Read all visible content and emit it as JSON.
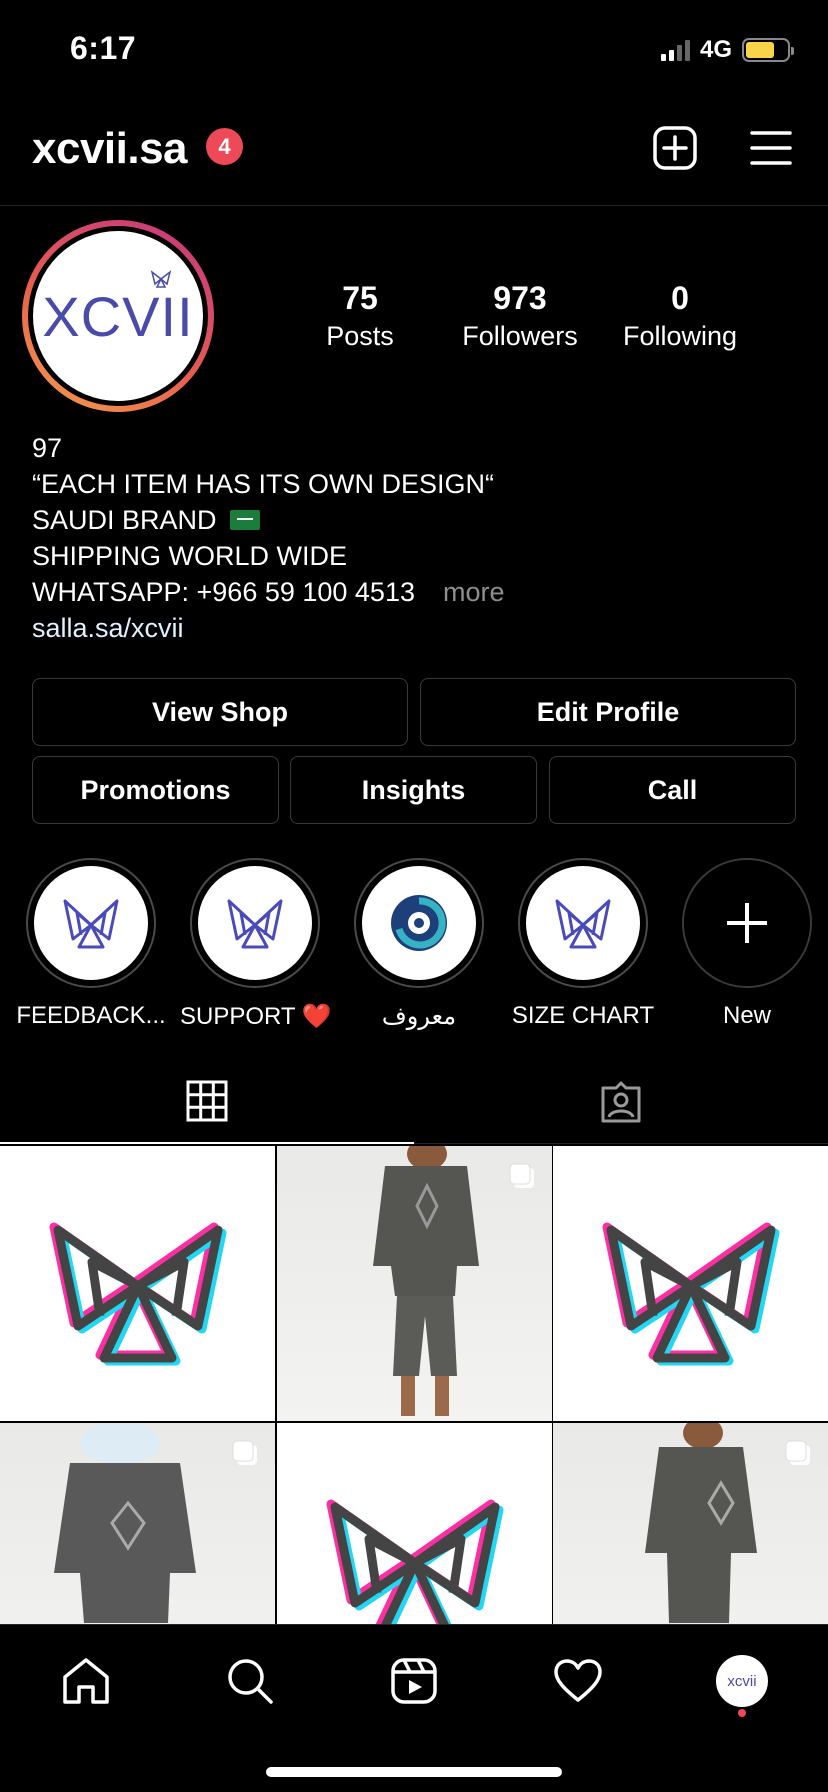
{
  "status_bar": {
    "time": "6:17",
    "network": "4G",
    "battery_level": 0.7
  },
  "header": {
    "username": "xcvii.sa",
    "notification_count": "4"
  },
  "profile": {
    "avatar_text": "XCVII",
    "stats": [
      {
        "number": "75",
        "label": "Posts"
      },
      {
        "number": "973",
        "label": "Followers"
      },
      {
        "number": "0",
        "label": "Following"
      }
    ],
    "bio": {
      "name": "97",
      "line1": "“EACH ITEM HAS ITS OWN DESIGN“",
      "line2": "SAUDI BRAND",
      "line3": "SHIPPING WORLD WIDE",
      "line4": "WHATSAPP: +966 59 100 4513",
      "more": "more",
      "link": "salla.sa/xcvii"
    }
  },
  "buttons": {
    "view_shop": "View Shop",
    "edit_profile": "Edit Profile",
    "promotions": "Promotions",
    "insights": "Insights",
    "call": "Call"
  },
  "highlights": [
    {
      "label": "FEEDBACK...",
      "icon": "butterfly-logo-icon"
    },
    {
      "label": "SUPPORT ❤️",
      "icon": "butterfly-logo-icon"
    },
    {
      "label": "معروف",
      "icon": "maroof-logo-icon"
    },
    {
      "label": "SIZE CHART",
      "icon": "butterfly-logo-icon"
    },
    {
      "label": "New",
      "icon": "plus-icon"
    }
  ],
  "tabs": [
    "grid-icon",
    "tagged-icon"
  ],
  "bottom_nav": {
    "avatar_text": "xcvii"
  },
  "colors": {
    "badge": "#ed4956",
    "brand_purple": "#4a4aa8",
    "background": "#000000"
  }
}
